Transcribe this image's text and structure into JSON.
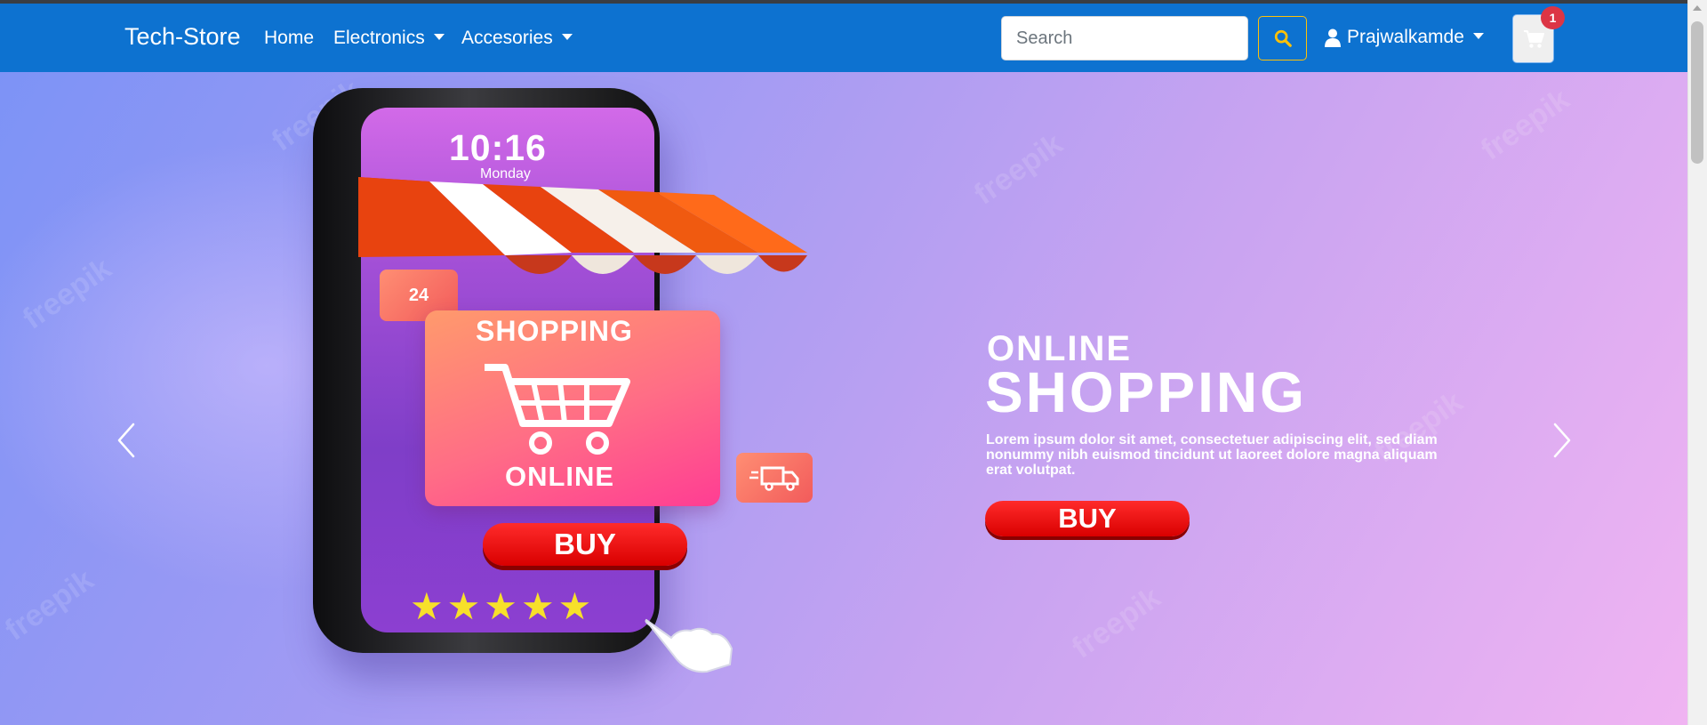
{
  "navbar": {
    "brand": "Tech-Store",
    "links": [
      {
        "label": "Home",
        "has_dropdown": false
      },
      {
        "label": "Electronics",
        "has_dropdown": true
      },
      {
        "label": "Accesories",
        "has_dropdown": true
      }
    ],
    "search": {
      "placeholder": "Search",
      "value": ""
    },
    "user": {
      "name": "Prajwalkamde"
    },
    "cart": {
      "count": "1"
    },
    "colors": {
      "navbar": "#0d72d0",
      "search_button_border": "#ffc107",
      "badge": "#dc3545"
    }
  },
  "carousel": {
    "slide": {
      "phone": {
        "time": "10:16",
        "day": "Monday",
        "badge_text": "24",
        "card_top": "SHOPPING",
        "card_bottom": "ONLINE",
        "buy_label": "BUY",
        "rating_stars": 5
      },
      "subtitle": "ONLINE",
      "title": "SHOPPING",
      "text": "Lorem ipsum dolor sit amet, consectetuer adipiscing elit, sed diam nonummy nibh euismod tincidunt ut laoreet dolore magna aliquam erat volutpat.",
      "buy_label": "BUY",
      "watermark": "freepik"
    },
    "controls": {
      "prev_icon": "chevron-left-icon",
      "next_icon": "chevron-right-icon"
    }
  }
}
